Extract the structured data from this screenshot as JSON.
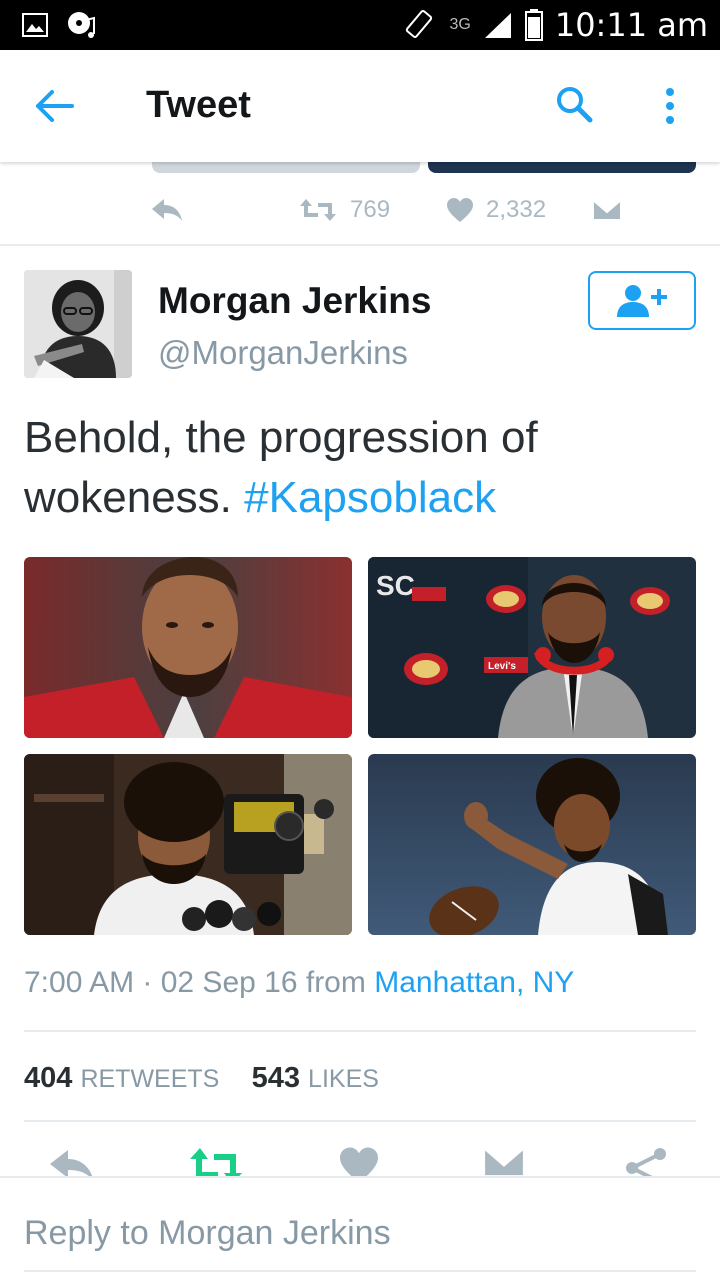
{
  "status_bar": {
    "network": "3G",
    "time": "10:11 am",
    "icons": [
      "image-notification-icon",
      "music-notification-icon",
      "rotate-icon",
      "signal-icon",
      "battery-icon"
    ]
  },
  "app_bar": {
    "title": "Tweet",
    "icons": [
      "back-arrow-icon",
      "search-icon",
      "more-vert-icon"
    ]
  },
  "previous_tweet": {
    "retweets": "769",
    "likes": "2,332"
  },
  "tweet": {
    "author_name": "Morgan Jerkins",
    "author_handle": "@MorganJerkins",
    "text": "Behold, the progression of wokeness.",
    "hashtag": "#Kapsoblack",
    "media_overlay_texts": [
      "SC",
      "Levi's",
      "Levi's"
    ],
    "timestamp": "7:00 AM · 02 Sep 16",
    "from_label": "from",
    "location": "Manhattan, NY",
    "retweet_count": "404",
    "retweet_label": "RETWEETS",
    "like_count": "543",
    "like_label": "LIKES"
  },
  "reply": {
    "placeholder": "Reply to Morgan Jerkins"
  },
  "colors": {
    "accent": "#1da1f2",
    "retweet_green": "#19cf86",
    "muted": "#8899a6",
    "text": "#292f33"
  }
}
